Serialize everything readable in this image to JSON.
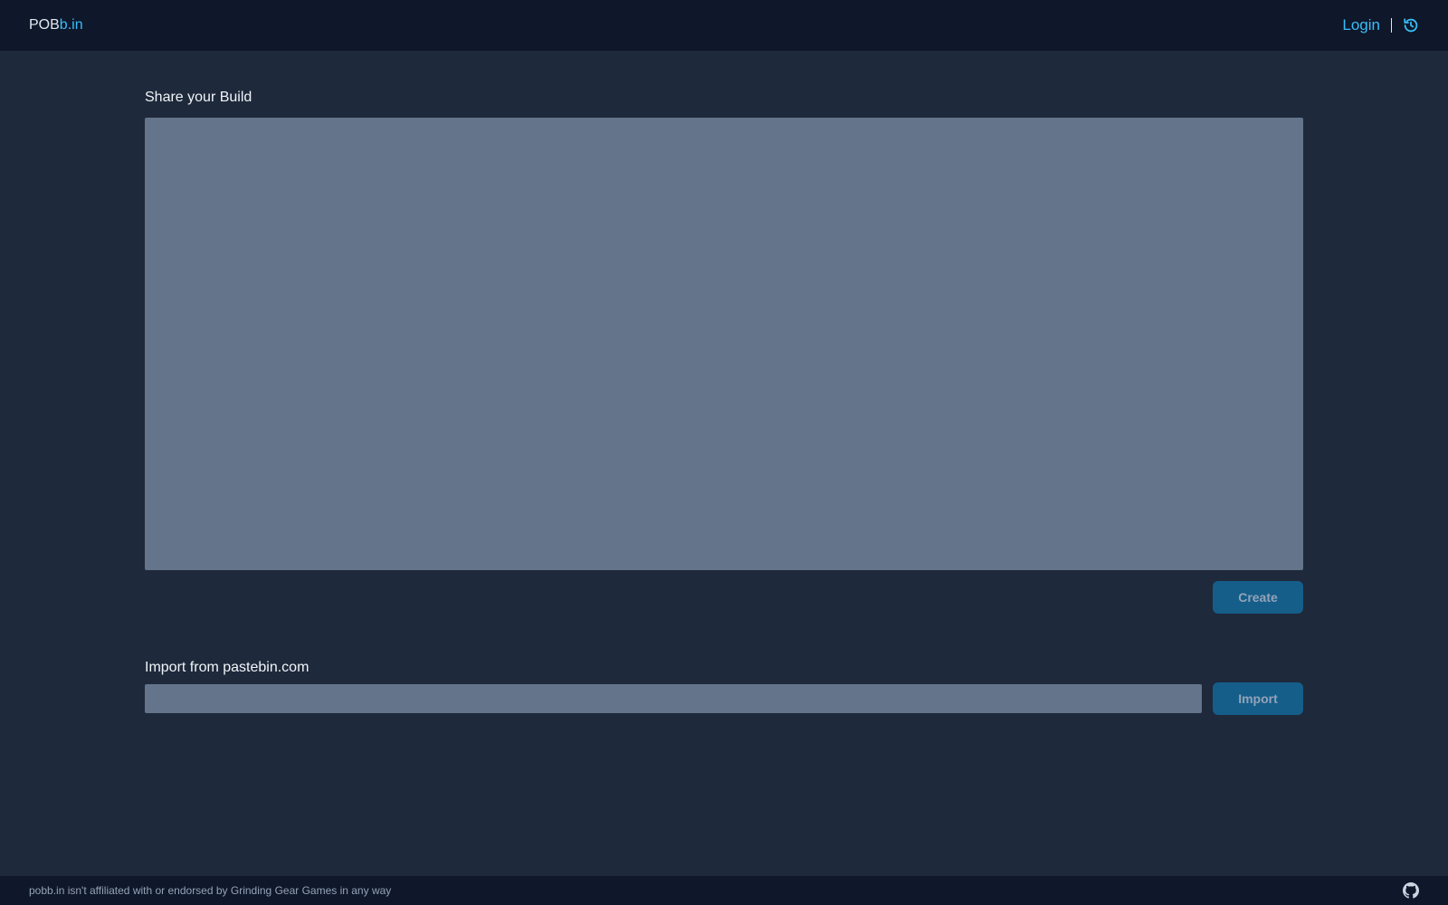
{
  "header": {
    "logo_main": "POB",
    "logo_accent": "b.in",
    "login_label": "Login",
    "history_icon": "history-icon"
  },
  "share": {
    "title": "Share your Build",
    "textarea_value": "",
    "create_label": "Create"
  },
  "import": {
    "title": "Import from pastebin.com",
    "input_value": "",
    "import_label": "Import"
  },
  "footer": {
    "disclaimer": "pobb.in isn't affiliated with or endorsed by Grinding Gear Games in any way",
    "github_icon": "github-icon"
  },
  "colors": {
    "background": "#1e293b",
    "bar": "#0f172a",
    "accent": "#38bdf8",
    "field": "#64748b",
    "button": "#155e8a"
  }
}
